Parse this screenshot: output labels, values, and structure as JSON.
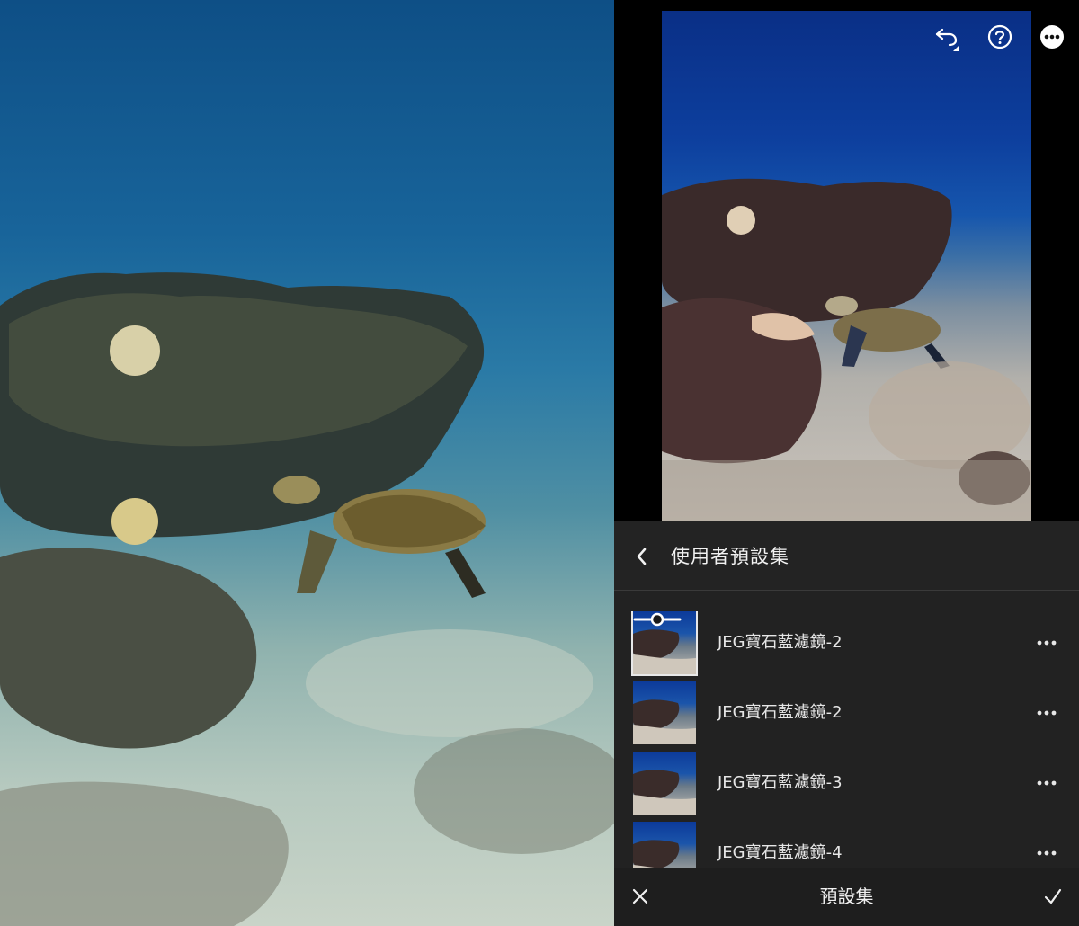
{
  "header": {
    "undo_icon": "undo-icon",
    "help_icon": "help-icon",
    "more_icon": "more-options-icon"
  },
  "sheet": {
    "title": "使用者預設集",
    "back_icon": "chevron-left-icon"
  },
  "presets": [
    {
      "name": "JEG寶石藍濾鏡-2",
      "selected": true
    },
    {
      "name": "JEG寶石藍濾鏡-2",
      "selected": false
    },
    {
      "name": "JEG寶石藍濾鏡-3",
      "selected": false
    },
    {
      "name": "JEG寶石藍濾鏡-4",
      "selected": false
    }
  ],
  "bottom_bar": {
    "title": "預設集",
    "cancel_icon": "close-icon",
    "confirm_icon": "checkmark-icon"
  },
  "colors": {
    "panel_bg": "#222222",
    "text": "#e6e6e6",
    "preview_blue": "#0d3f9e"
  }
}
